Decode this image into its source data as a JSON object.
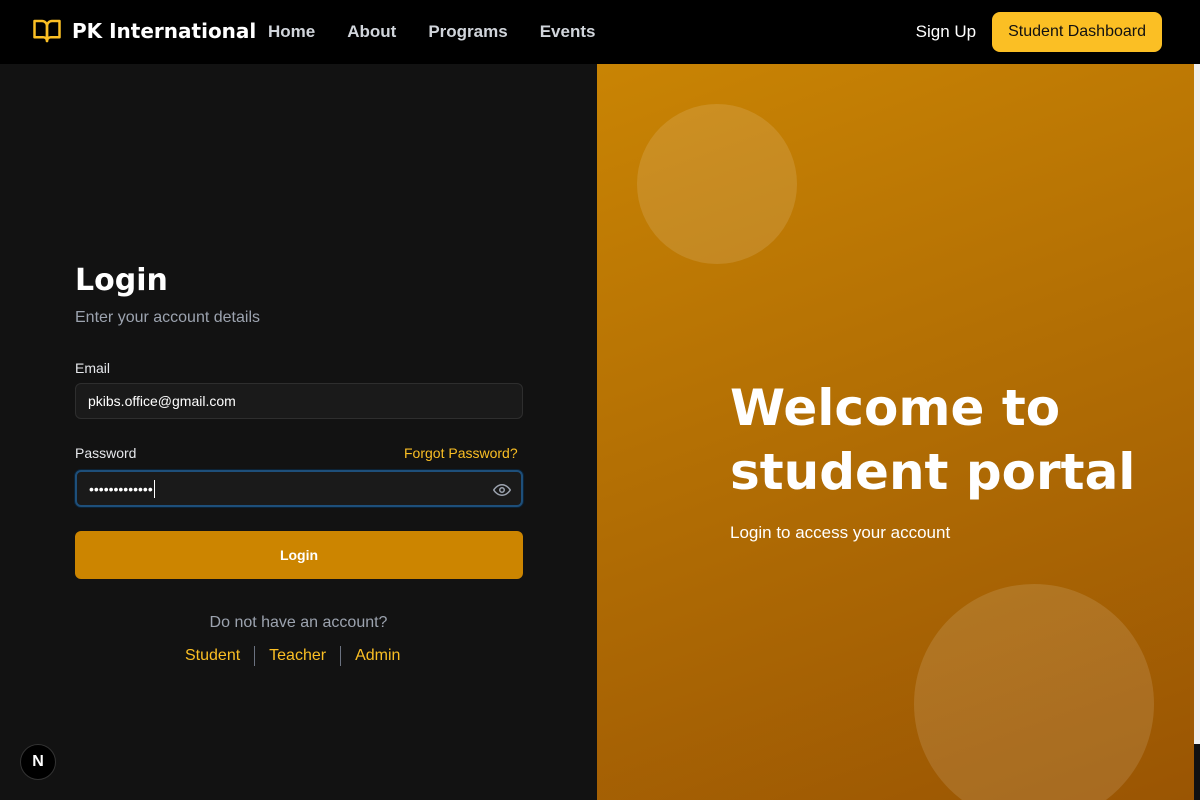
{
  "nav": {
    "brand": "PK International",
    "links": [
      "Home",
      "About",
      "Programs",
      "Events"
    ],
    "signup": "Sign Up",
    "dashboard": "Student Dashboard"
  },
  "login": {
    "title": "Login",
    "subtitle": "Enter your account details",
    "email_label": "Email",
    "email_value": "pkibs.office@gmail.com",
    "password_label": "Password",
    "forgot": "Forgot Password?",
    "password_masked": "•••••••••••••",
    "button": "Login",
    "no_account": "Do not have an account?",
    "roles": [
      "Student",
      "Teacher",
      "Admin"
    ]
  },
  "hero": {
    "title": "Welcome to student portal",
    "subtitle": "Login to access your account"
  },
  "badge": "N",
  "colors": {
    "accent": "#fbbf24",
    "button": "#cc8500",
    "panel_gradient_start": "#c98404",
    "panel_gradient_end": "#9a5503"
  }
}
